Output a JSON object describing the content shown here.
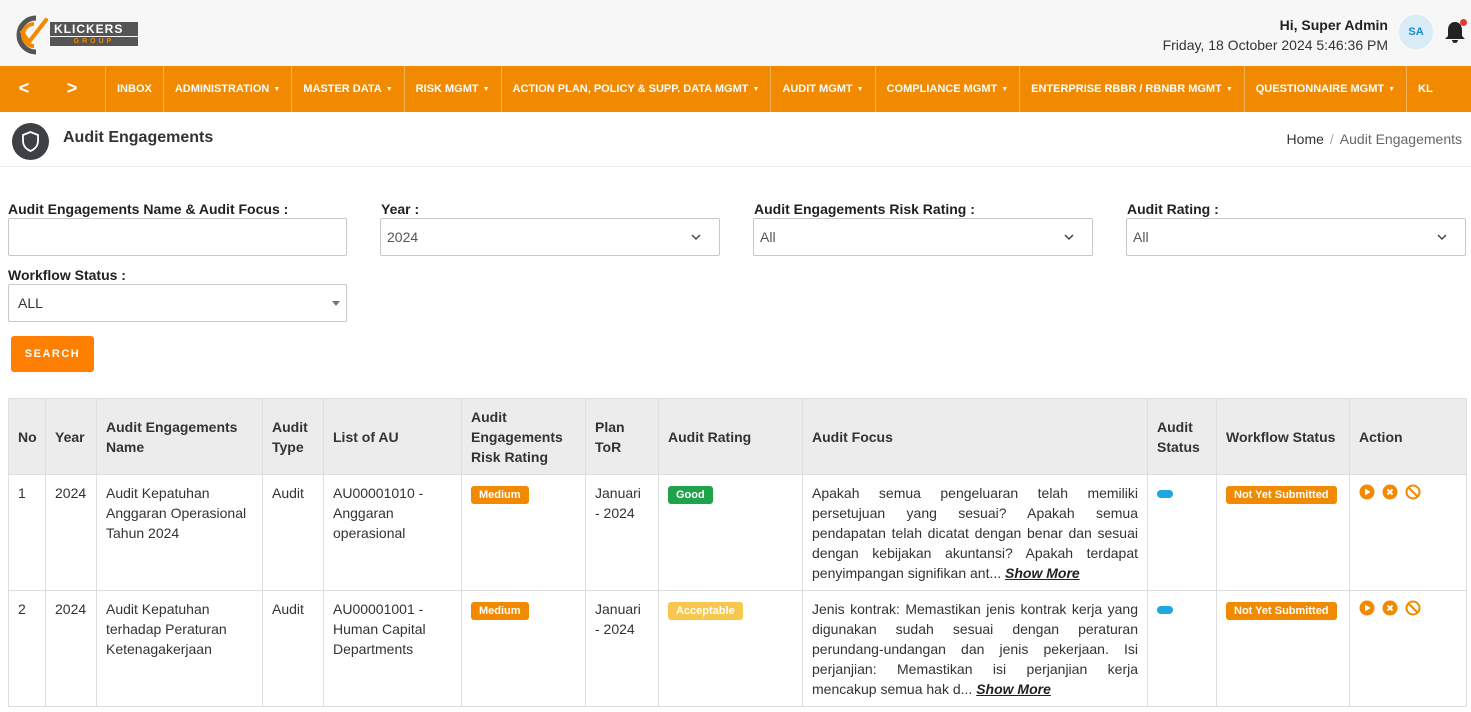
{
  "header": {
    "logo_brand": "KLICKERS",
    "logo_group": "GROUP",
    "greeting": "Hi, Super Admin",
    "datetime": "Friday, 18 October 2024 5:46:36 PM",
    "avatar": "SA",
    "bell_icon": "bell-icon"
  },
  "nav": {
    "prev_arrow": "<",
    "next_arrow": ">",
    "items": [
      {
        "label": "INBOX"
      },
      {
        "label": "ADMINISTRATION"
      },
      {
        "label": "MASTER DATA"
      },
      {
        "label": "RISK MGMT"
      },
      {
        "label": "ACTION PLAN, POLICY & SUPP. DATA MGMT"
      },
      {
        "label": "AUDIT MGMT"
      },
      {
        "label": "COMPLIANCE MGMT"
      },
      {
        "label": "ENTERPRISE RBBR / RBNBR MGMT"
      },
      {
        "label": "QUESTIONNAIRE MGMT"
      },
      {
        "label": "KL"
      }
    ]
  },
  "page": {
    "title": "Audit Engagements",
    "breadcrumb_home": "Home",
    "breadcrumb_sep": "/",
    "breadcrumb_current": "Audit Engagements"
  },
  "filters": {
    "name_label": "Audit Engagements Name & Audit Focus :",
    "name_value": "",
    "year_label": "Year :",
    "year_value": "2024",
    "risk_label": "Audit Engagements Risk Rating :",
    "risk_value": "All",
    "rating_label": "Audit Rating :",
    "rating_value": "All",
    "workflow_label": "Workflow Status :",
    "workflow_value": "ALL",
    "search_label": "SEARCH"
  },
  "table": {
    "headers": {
      "no": "No",
      "year": "Year",
      "name": "Audit Engagements Name",
      "type": "Audit Type",
      "au": "List of AU",
      "risk": "Audit Engagements Risk Rating",
      "tor": "Plan ToR",
      "rating": "Audit Rating",
      "focus": "Audit Focus",
      "status": "Audit Status",
      "workflow": "Workflow Status",
      "action": "Action"
    },
    "show_more": "Show More",
    "rows": [
      {
        "no": "1",
        "year": "2024",
        "name": "Audit Kepatuhan Anggaran Operasional Tahun 2024",
        "type": "Audit",
        "au": "AU00001010 - Anggaran operasional",
        "risk": "Medium",
        "tor": "Januari - 2024",
        "rating": "Good",
        "rating_color": "#1fa34a",
        "focus": "Apakah semua pengeluaran telah memiliki persetujuan yang sesuai? Apakah semua pendapatan telah dicatat dengan benar dan sesuai dengan kebijakan akuntansi? Apakah terdapat penyimpangan signifikan ant...",
        "workflow": "Not Yet Submitted"
      },
      {
        "no": "2",
        "year": "2024",
        "name": "Audit Kepatuhan terhadap Peraturan Ketenagakerjaan",
        "type": "Audit",
        "au": "AU00001001 - Human Capital Departments",
        "risk": "Medium",
        "tor": "Januari - 2024",
        "rating": "Acceptable",
        "rating_color": "#f8c84e",
        "focus": "Jenis kontrak: Memastikan jenis kontrak kerja yang digunakan sudah sesuai dengan peraturan perundang-undangan dan jenis pekerjaan. Isi perjanjian: Memastikan isi perjanjian kerja mencakup semua hak d...",
        "workflow": "Not Yet Submitted"
      }
    ]
  },
  "colors": {
    "accent": "#f18a00",
    "nav_bg": "#f18a00",
    "search_button": "#ff7f00",
    "status_pill": "#1ea7e1"
  }
}
